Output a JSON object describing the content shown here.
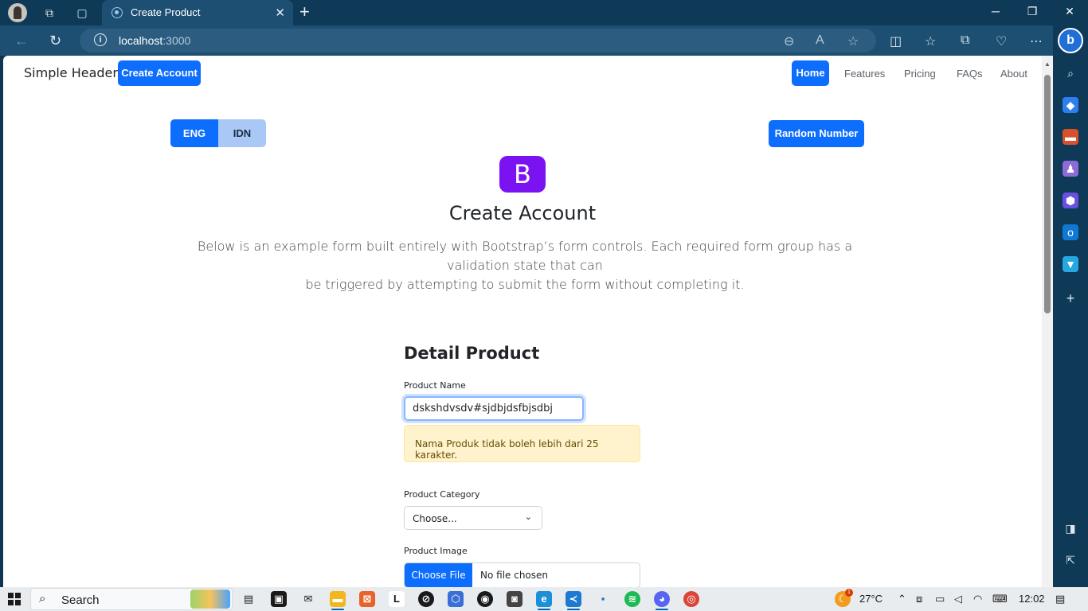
{
  "browser": {
    "tab_title": "Create Product",
    "url_host": "localhost",
    "url_port": ":3000"
  },
  "header": {
    "brand": "Simple Header",
    "create_account": "Create Account",
    "nav": [
      "Home",
      "Features",
      "Pricing",
      "FAQs",
      "About"
    ]
  },
  "lang": {
    "eng": "ENG",
    "idn": "IDN"
  },
  "random_button": "Random Number",
  "hero": {
    "logo_letter": "B",
    "title": "Create Account",
    "lead_line1": "Below is an example form built entirely with Bootstrap’s form controls. Each required form group has a validation state that can",
    "lead_line2": "be triggered by attempting to submit the form without completing it."
  },
  "form": {
    "section_title": "Detail Product",
    "product_name_label": "Product Name",
    "product_name_value": "dskshdvsdv#sjdbjdsfbjsdbj",
    "alert": "Nama Produk tidak boleh lebih dari 25 karakter.",
    "category_label": "Product Category",
    "category_selected": "Choose...",
    "image_label": "Product Image",
    "file_button": "Choose File",
    "file_status": "No file chosen"
  },
  "taskbar": {
    "search": "Search",
    "weather": "27°C",
    "time": "12:02",
    "weather_badge": "1"
  }
}
